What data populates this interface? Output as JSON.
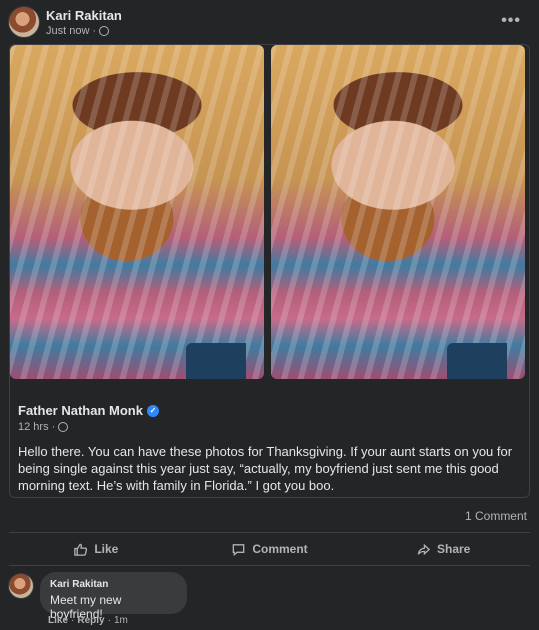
{
  "header": {
    "author": "Kari Rakitan",
    "time": "Just now",
    "separator": "·",
    "more_label": "•••",
    "privacy_icon": "globe-icon"
  },
  "shared": {
    "author": "Father Nathan Monk",
    "verified_icon": "verified-badge-icon",
    "time": "12 hrs",
    "separator": "·",
    "text": "Hello there. You can have these photos for Thanksgiving. If your aunt starts on you for being single against this year just say, “actually, my boyfriend just sent me this good morning text. He’s with family in Florida.” I got you boo.",
    "photos": [
      "photo-1",
      "photo-2"
    ]
  },
  "counts": {
    "comments": "1 Comment"
  },
  "actions": {
    "like": "Like",
    "comment": "Comment",
    "share": "Share"
  },
  "comment": {
    "author": "Kari Rakitan",
    "text": "Meet my new boyfriend!",
    "like": "Like",
    "reply": "Reply",
    "time": "1m",
    "separator": "·"
  },
  "colors": {
    "background": "#242526",
    "text": "#e4e6eb",
    "muted": "#b0b3b8",
    "accent": "#2d88ff",
    "bubble": "#3a3b3c"
  }
}
